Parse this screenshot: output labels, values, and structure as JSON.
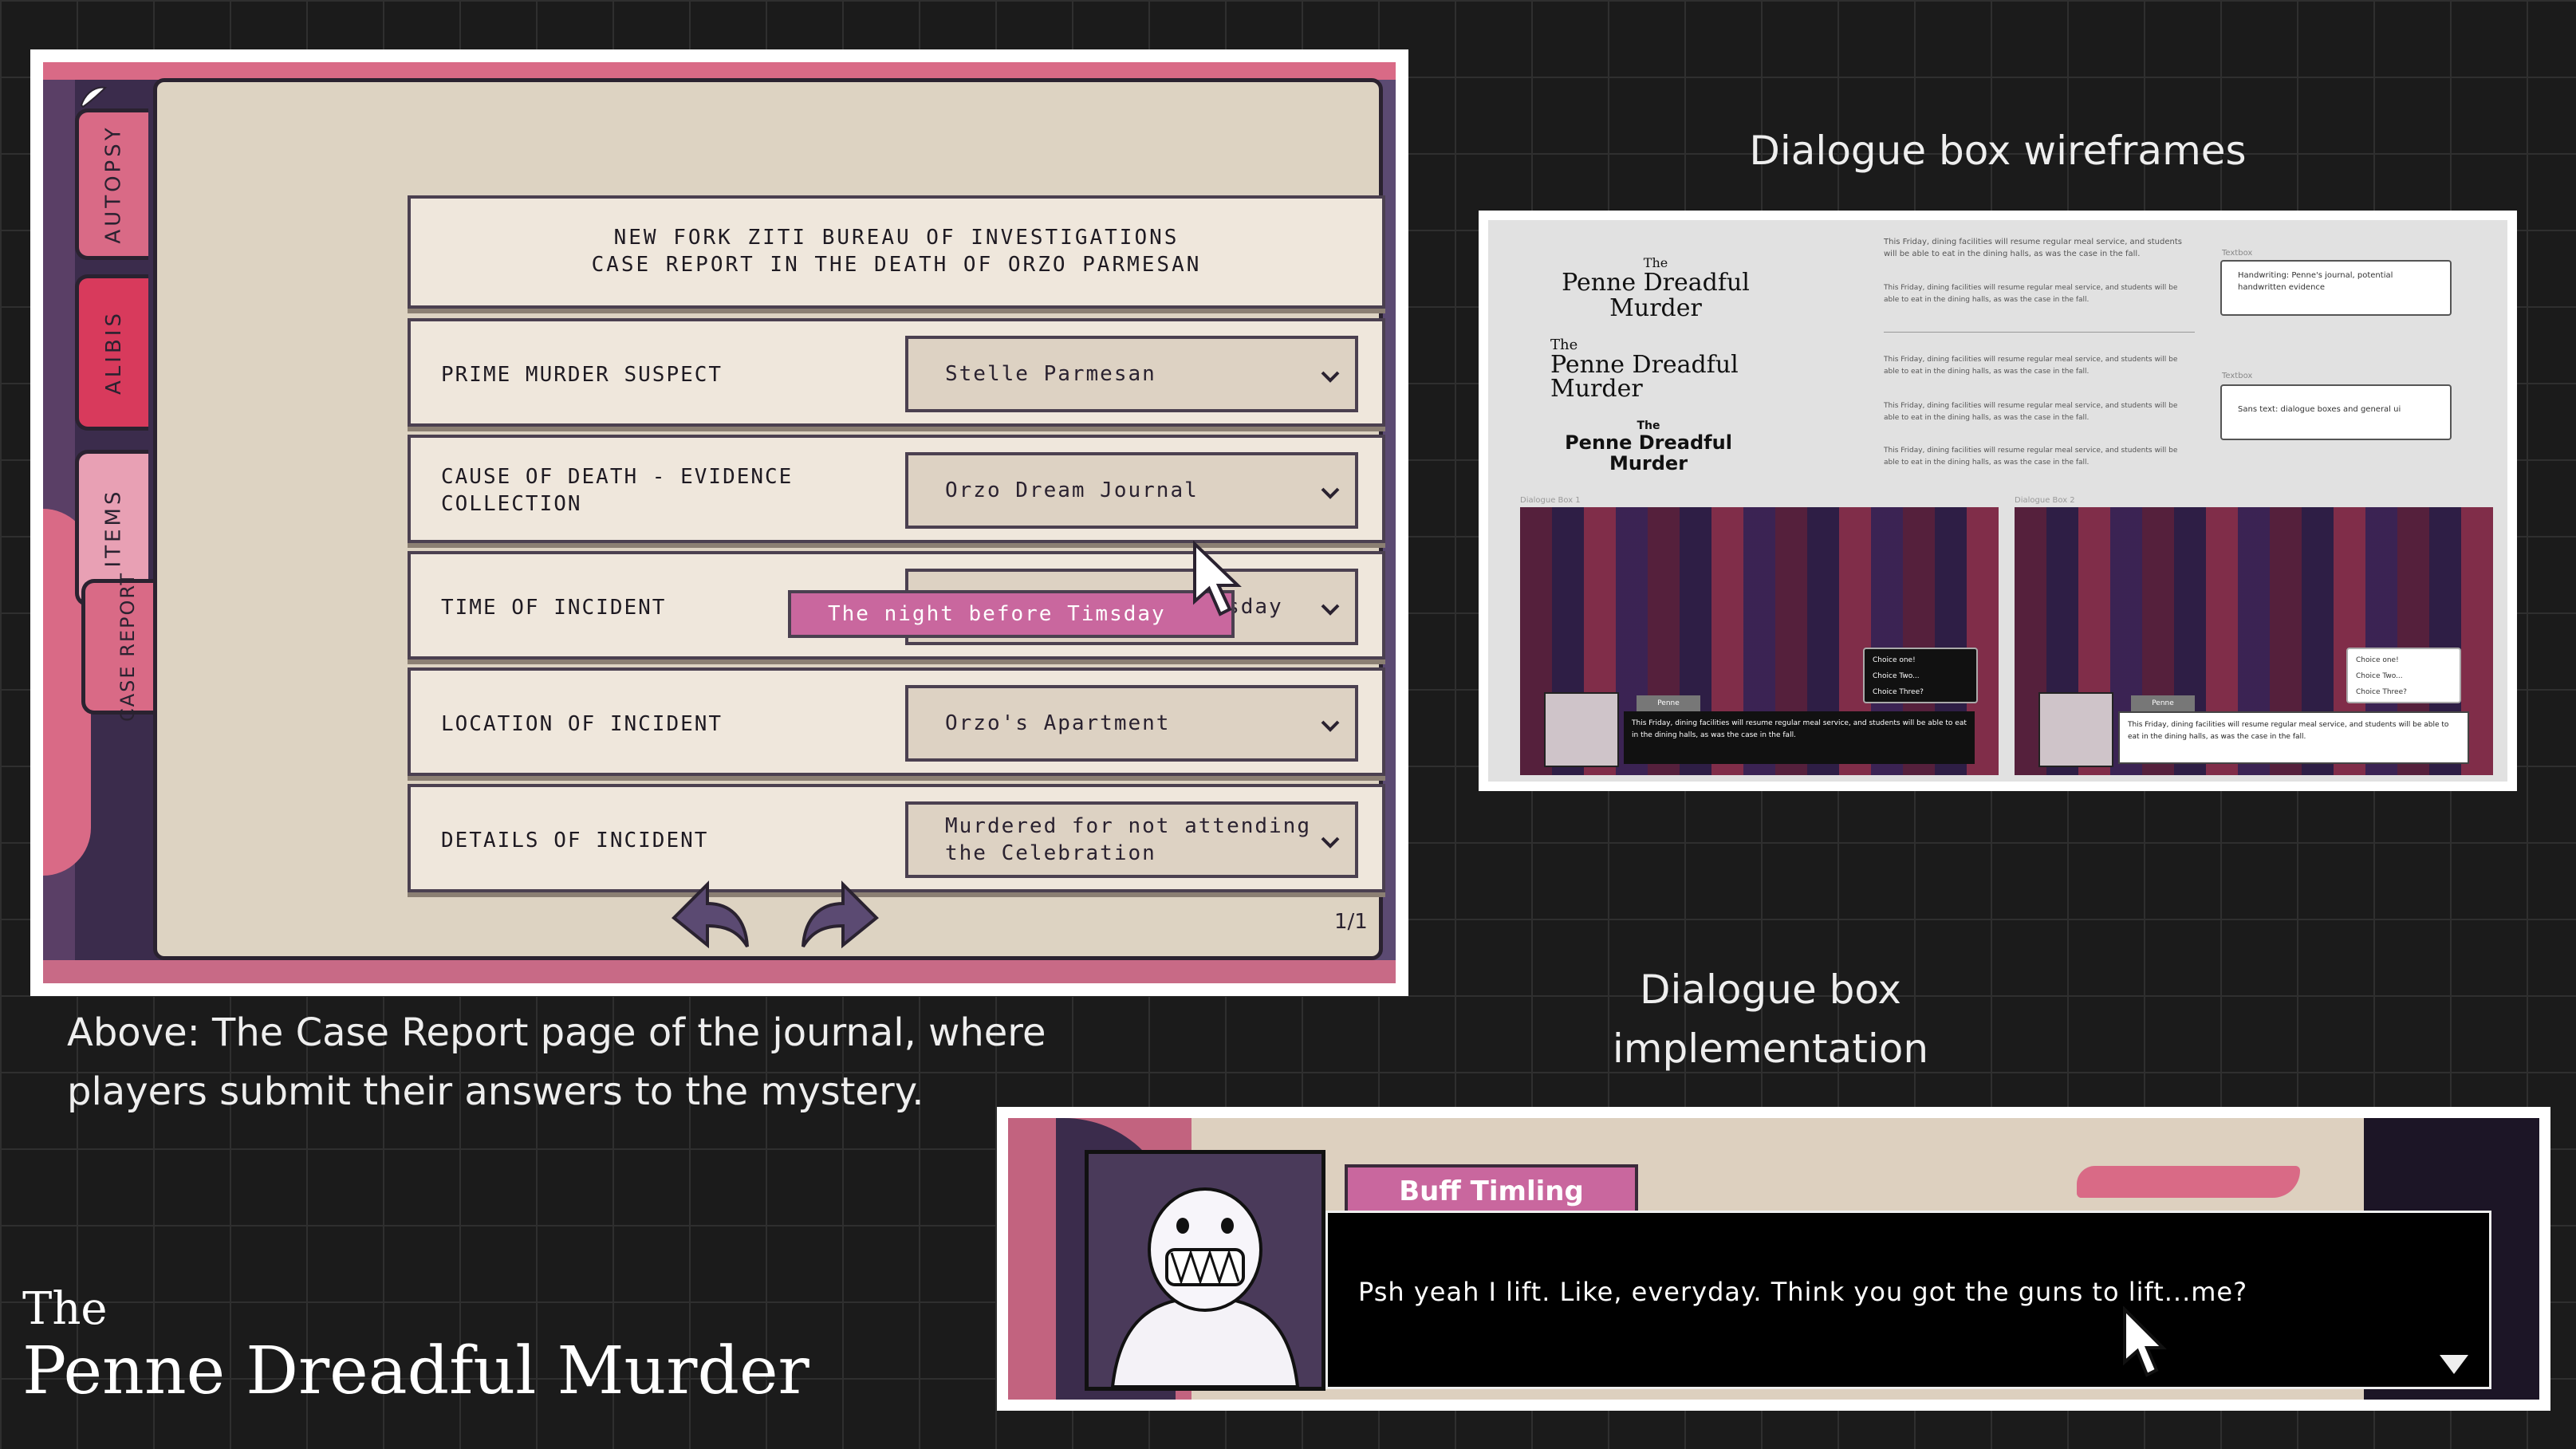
{
  "case_report": {
    "tabs": [
      "AUTOPSY",
      "ALIBIS",
      "ITEMS",
      "CASE REPORT"
    ],
    "header_line1": "NEW FORK ZITI BUREAU OF INVESTIGATIONS",
    "header_line2": "CASE REPORT IN THE DEATH OF ORZO PARMESAN",
    "rows": [
      {
        "label": "PRIME MURDER SUSPECT",
        "value": "Stelle Parmesan"
      },
      {
        "label": "CAUSE OF DEATH - EVIDENCE COLLECTION",
        "value": "Orzo Dream Journal"
      },
      {
        "label": "TIME OF INCIDENT",
        "value": "The night before Timsday"
      },
      {
        "label": "LOCATION OF INCIDENT",
        "value": "Orzo's Apartment"
      },
      {
        "label": "DETAILS OF INCIDENT",
        "value": "Murdered for not attending the Celebration"
      }
    ],
    "dropdown_option": "The night before Timsday",
    "page_indicator": "1/1"
  },
  "caption_case": "Above: The Case Report page of the journal, where players submit their answers to the mystery.",
  "wireframes": {
    "title": "Dialogue box wireframes",
    "logo_the": "The",
    "logo_name": "Penne Dreadful Murder",
    "body_text": "This Friday, dining facilities will resume regular meal service, and students will be able to eat in the dining halls, as was the case in the fall.",
    "textbox_label_1": "Textbox",
    "textbox_text_1": "Handwriting: Penne's journal, potential handwritten evidence",
    "textbox_label_2": "Textbox",
    "textbox_text_2": "Sans text: dialogue boxes and general ui",
    "box1_label": "Dialogue Box 1",
    "box2_label": "Dialogue Box 2",
    "speaker": "Penne",
    "choices": [
      "Choice one!",
      "Choice Two...",
      "Choice Three?"
    ]
  },
  "implementation": {
    "title": "Dialogue box implementation",
    "speaker": "Buff Timling",
    "line": "Psh yeah I lift. Like, everyday. Think you got the guns to lift...me?"
  },
  "game_title": {
    "the": "The",
    "name": "Penne Dreadful Murder"
  },
  "colors": {
    "background": "#1b1b1b",
    "paper": "#ddd3c2",
    "accent_pink": "#c9679e",
    "deep_purple": "#3b2c4c"
  }
}
